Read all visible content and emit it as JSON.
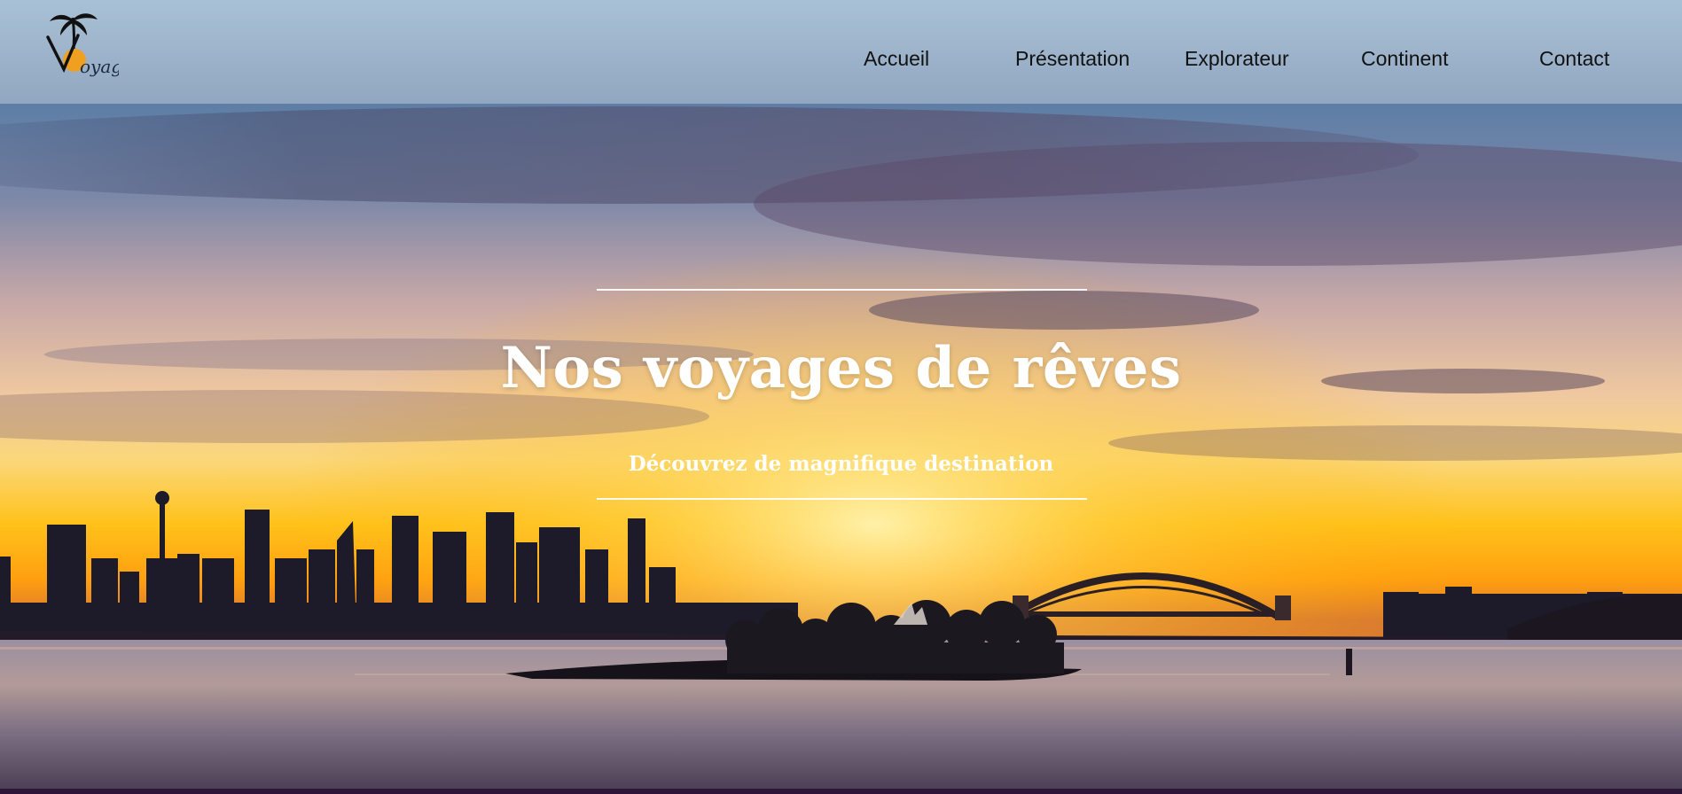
{
  "logo": {
    "letters": "Voyage",
    "brand_color": "#f0a020"
  },
  "nav": {
    "items": [
      {
        "label": "Accueil"
      },
      {
        "label": "Présentation"
      },
      {
        "label": "Explorateur"
      },
      {
        "label": "Continent"
      },
      {
        "label": "Contact"
      }
    ]
  },
  "hero": {
    "title": "Nos voyages de rêves",
    "subtitle": "Découvrez de magnifique destination",
    "image": "sydney-harbour-sunset-skyline"
  },
  "colors": {
    "sky_top": "#3f6a9a",
    "sunset": "#ffb400",
    "water": "#6e6780",
    "header_overlay": "#c4cfdc",
    "text_on_hero": "#ffffff"
  }
}
